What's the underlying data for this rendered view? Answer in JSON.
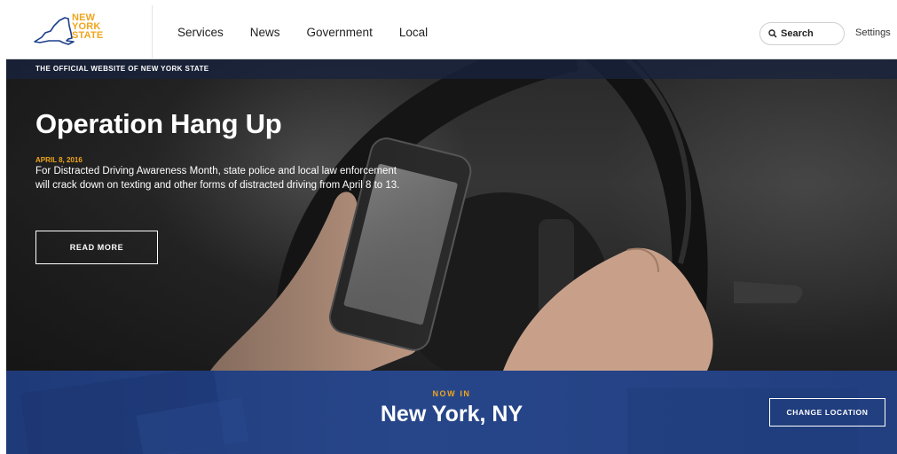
{
  "header": {
    "logo": {
      "line1": "NEW",
      "line2": "YORK",
      "line3": "STATE"
    },
    "nav": [
      "Services",
      "News",
      "Government",
      "Local"
    ],
    "search_label": "Search",
    "settings_label": "Settings"
  },
  "hero": {
    "official_banner": "THE OFFICIAL WEBSITE OF NEW YORK STATE",
    "title": "Operation Hang Up",
    "date": "APRIL 8, 2016",
    "description": "For Distracted Driving Awareness Month, state police and local law enforcement will crack down on texting and other forms of distracted driving from April 8 to 13.",
    "cta_label": "READ MORE"
  },
  "location": {
    "prefix": "NOW IN",
    "city": "New York, NY",
    "change_label": "CHANGE LOCATION"
  },
  "colors": {
    "accent_gold": "#f0a51b",
    "location_blue": "#27468a",
    "banner_navy": "#18223e"
  },
  "icons": [
    "ny-state-outline-icon",
    "search-icon"
  ]
}
